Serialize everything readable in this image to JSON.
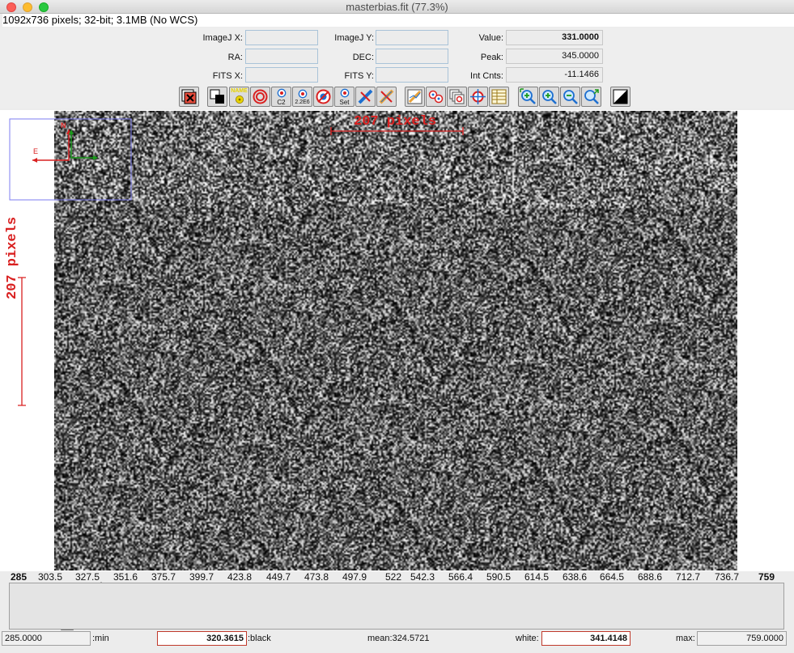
{
  "window": {
    "title": "masterbias.fit (77.3%)"
  },
  "info_line": "1092x736 pixels; 32-bit; 3.1MB (No WCS)",
  "coords": {
    "imagej_x_label": "ImageJ X:",
    "imagej_x": "",
    "imagej_y_label": "ImageJ Y:",
    "imagej_y": "",
    "value_label": "Value:",
    "value": "331.0000",
    "ra_label": "RA:",
    "ra": "",
    "dec_label": "DEC:",
    "dec": "",
    "peak_label": "Peak:",
    "peak": "345.0000",
    "fits_x_label": "FITS X:",
    "fits_x": "",
    "fits_y_label": "FITS Y:",
    "fits_y": "",
    "intcnts_label": "Int Cnts:",
    "intcnts": "-11.1466"
  },
  "toolbar": {
    "name_btn": "NAME",
    "c2_btn": "C2",
    "b226_btn": "2.2E6",
    "set_btn": "Set"
  },
  "overlay": {
    "hscale_label": "207 pixels",
    "vscale_label": "207 pixels",
    "compass_e": "E",
    "compass_n": "N"
  },
  "histogram": {
    "ticks": [
      "285",
      "303.5",
      "327.5",
      "351.6",
      "375.7",
      "399.7",
      "423.8",
      "449.7",
      "473.8",
      "497.9",
      "522",
      "542.3",
      "566.4",
      "590.5",
      "614.5",
      "638.6",
      "664.5",
      "688.6",
      "712.7",
      "736.7",
      "759"
    ]
  },
  "bottom": {
    "min_value": "285.0000",
    "min_label": ":min",
    "black_value": "320.3615",
    "black_label": ":black",
    "mean_text": "mean:324.5721",
    "white_label": "white:",
    "white_value": "341.4148",
    "max_label": "max:",
    "max_value": "759.0000"
  },
  "colors": {
    "accent_red": "#d92020",
    "histo_blue": "#8ab4f8",
    "histo_gray": "#b8b8b8"
  }
}
